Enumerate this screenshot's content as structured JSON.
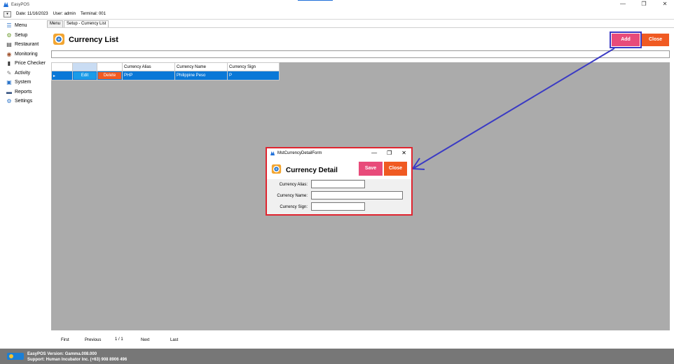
{
  "window": {
    "app_title": "EasyPOS",
    "minimize": "—",
    "restore": "❐",
    "close": "✕"
  },
  "infobar": {
    "dropdown": "▾",
    "date": "Date: 11/16/2023",
    "user": "User: admin",
    "terminal": "Terminal: 001"
  },
  "sidebar": {
    "items": [
      {
        "label": "Menu",
        "icon": "menu-icon",
        "glyph": "☰",
        "color": "#2b74c9"
      },
      {
        "label": "Setup",
        "icon": "setup-icon",
        "glyph": "⚙",
        "color": "#6a9a2a"
      },
      {
        "label": "Restaurant",
        "icon": "restaurant-icon",
        "glyph": "▤",
        "color": "#333333"
      },
      {
        "label": "Monitoring",
        "icon": "monitoring-icon",
        "glyph": "◉",
        "color": "#a0522d"
      },
      {
        "label": "Price Checker",
        "icon": "price-checker-icon",
        "glyph": "▮",
        "color": "#333333"
      },
      {
        "label": "Activity",
        "icon": "activity-icon",
        "glyph": "✎",
        "color": "#777777"
      },
      {
        "label": "System",
        "icon": "system-icon",
        "glyph": "▣",
        "color": "#2b74c9"
      },
      {
        "label": "Reports",
        "icon": "reports-icon",
        "glyph": "▬",
        "color": "#2b4a7a"
      },
      {
        "label": "Settings",
        "icon": "settings-icon",
        "glyph": "⚙",
        "color": "#2b74c9"
      }
    ]
  },
  "tabs": [
    {
      "label": "Menu"
    },
    {
      "label": "Setup - Currency List"
    }
  ],
  "page": {
    "title": "Currency List",
    "add_label": "Add",
    "close_label": "Close",
    "search_value": ""
  },
  "grid": {
    "headers": [
      "",
      "",
      "",
      "Currency Alias",
      "Currency Name",
      "Currency Sign"
    ],
    "rows": [
      {
        "indicator": "▸",
        "edit": "Edit",
        "delete": "Delete",
        "alias": "PHP",
        "name": "Philippine Peso",
        "sign": "P"
      }
    ]
  },
  "pager": {
    "first": "First",
    "previous": "Previous",
    "page": "1 / 1",
    "next": "Next",
    "last": "Last"
  },
  "footer": {
    "version": "EasyPOS Version: Gamma.008.000",
    "support": "Support: Human Incubator Inc. (+63) 908 8906 496"
  },
  "dialog": {
    "window_title": "MstCurrencyDetailForm",
    "heading": "Currency Detail",
    "save_label": "Save",
    "close_label": "Close",
    "fields": {
      "alias_label": "Currency Alias:",
      "alias_value": "",
      "name_label": "Currency Name:",
      "name_value": "",
      "sign_label": "Currency Sign:",
      "sign_value": ""
    }
  },
  "colors": {
    "add_button": "#e84b7a",
    "close_button": "#f05a22",
    "selected_row": "#0a78d7",
    "arrow": "#3b3bc4",
    "dialog_highlight": "#e0242f"
  }
}
